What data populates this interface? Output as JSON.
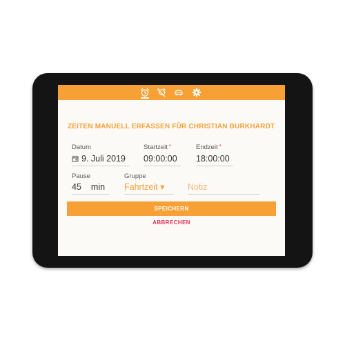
{
  "header": {
    "icons": [
      "alarm-clock-icon",
      "alarm-off-icon",
      "car-icon",
      "gear-icon"
    ]
  },
  "form": {
    "title": "ZEITEN MANUELL ERFASSEN FÜR CHRISTIAN BURKHARDT",
    "date": {
      "label": "Datum",
      "value": "9. Juli 2019"
    },
    "start": {
      "label": "Startzeit",
      "required_mark": "*",
      "value": "09:00:00"
    },
    "end": {
      "label": "Endzeit",
      "required_mark": "*",
      "value": "18:00:00"
    },
    "pause": {
      "label": "Pause",
      "value": "45",
      "unit": "min"
    },
    "group": {
      "label": "Gruppe",
      "value": "Fahrtzeit",
      "arrow": "▾"
    },
    "note": {
      "placeholder": "Notiz"
    },
    "save_label": "SPEICHERN",
    "cancel_label": "ABBRECHEN"
  },
  "colors": {
    "accent": "#f7a035",
    "danger": "#e03a5a",
    "bezel": "#141414",
    "screen": "#fbfaf7"
  }
}
